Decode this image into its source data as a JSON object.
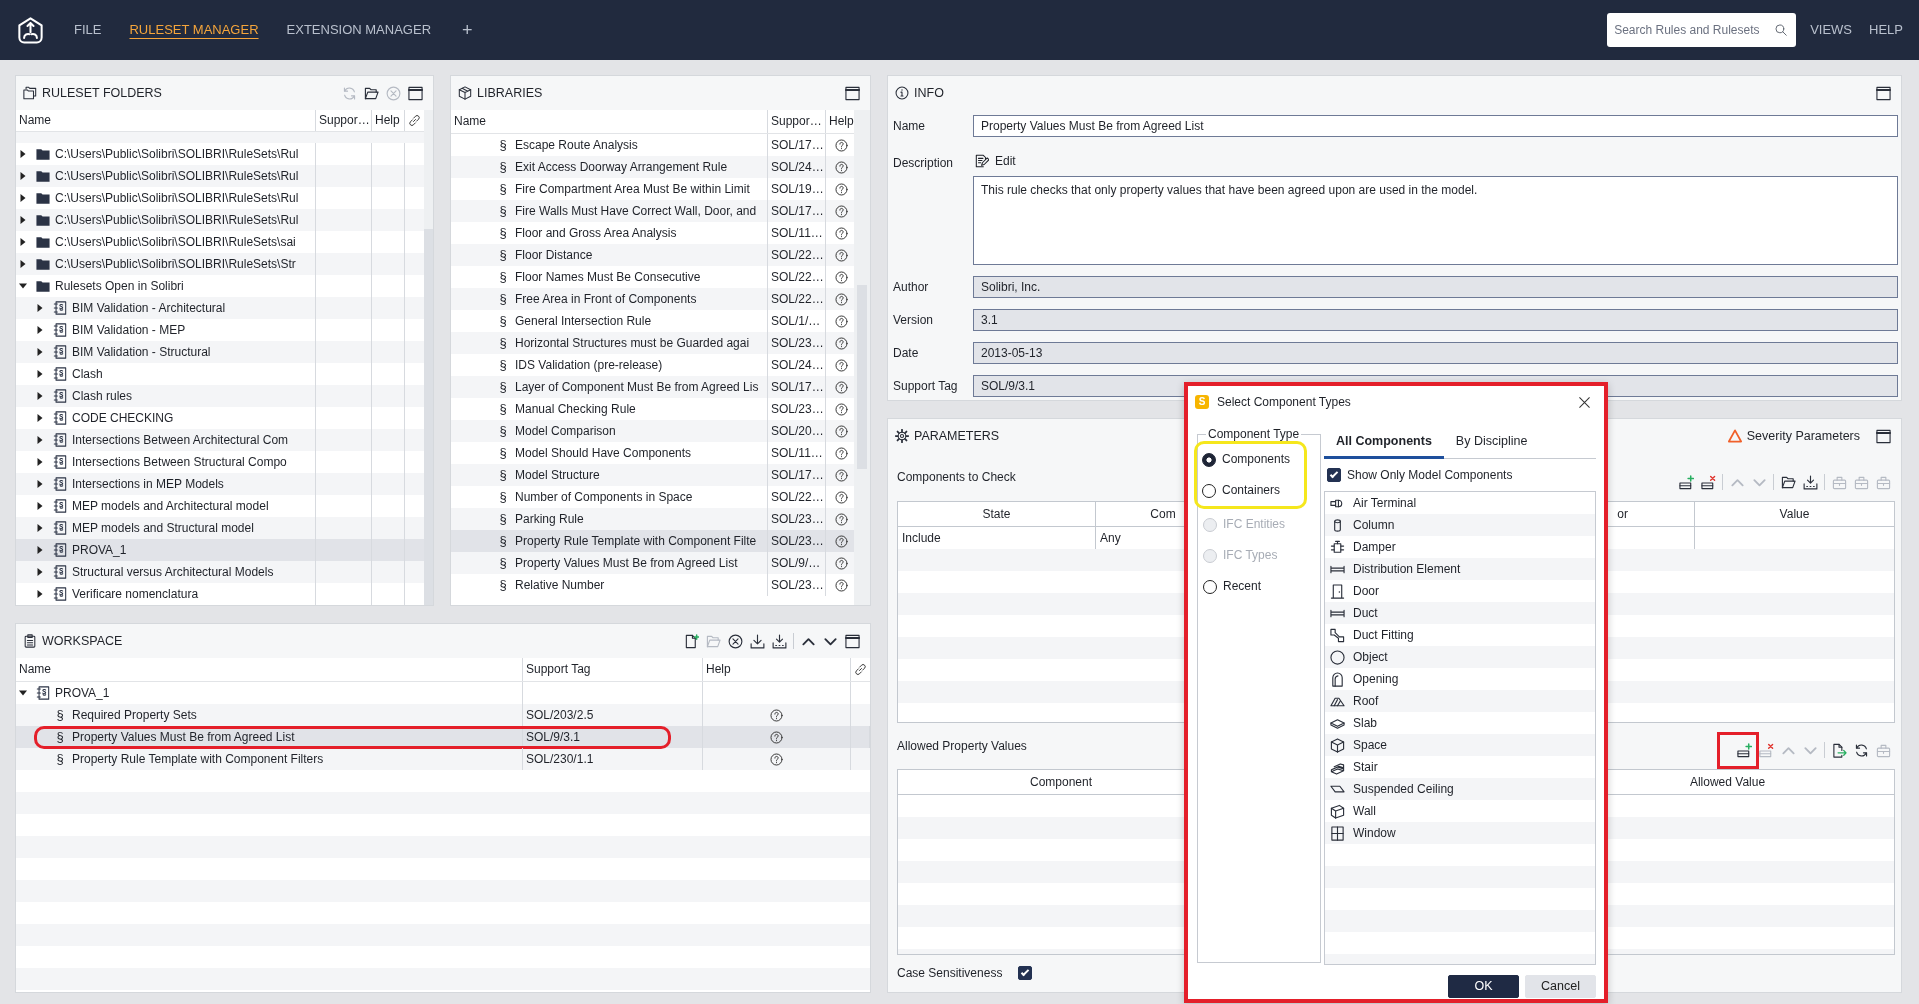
{
  "top_bar": {
    "menu": [
      {
        "label": "FILE",
        "selected": false
      },
      {
        "label": "RULESET MANAGER",
        "selected": true
      },
      {
        "label": "EXTENSION MANAGER",
        "selected": false
      }
    ],
    "add_tab": "+",
    "search": {
      "placeholder": "Search Rules and Rulesets"
    },
    "links": [
      "VIEWS",
      "HELP"
    ]
  },
  "ruleset_folders": {
    "title": "RULESET FOLDERS",
    "tools": [
      {
        "kind": "refresh",
        "disabled": true
      },
      {
        "kind": "open",
        "disabled": false
      },
      {
        "kind": "close",
        "disabled": true
      },
      {
        "kind": "maximize",
        "disabled": false
      }
    ],
    "columns": [
      "Name",
      "Suppor…",
      "Help"
    ],
    "tree": [
      {
        "kind": "folder",
        "label": "C:\\Users\\Public\\Solibri\\SOLIBRI\\RuleSets\\Rul",
        "expanded": false,
        "selected": false
      },
      {
        "kind": "folder",
        "label": "C:\\Users\\Public\\Solibri\\SOLIBRI\\RuleSets\\Rul",
        "expanded": false,
        "selected": false
      },
      {
        "kind": "folder",
        "label": "C:\\Users\\Public\\Solibri\\SOLIBRI\\RuleSets\\Rul",
        "expanded": false,
        "selected": false
      },
      {
        "kind": "folder",
        "label": "C:\\Users\\Public\\Solibri\\SOLIBRI\\RuleSets\\Rul",
        "expanded": false,
        "selected": false
      },
      {
        "kind": "folder",
        "label": "C:\\Users\\Public\\Solibri\\SOLIBRI\\RuleSets\\sai",
        "expanded": false,
        "selected": false
      },
      {
        "kind": "folder",
        "label": "C:\\Users\\Public\\Solibri\\SOLIBRI\\RuleSets\\Str",
        "expanded": false,
        "selected": false
      },
      {
        "kind": "folder",
        "label": "Rulesets Open in Solibri",
        "expanded": true,
        "selected": false,
        "children": [
          {
            "kind": "ruleset",
            "label": "BIM Validation - Architectural",
            "expanded": false,
            "selected": false
          },
          {
            "kind": "ruleset",
            "label": "BIM Validation - MEP",
            "expanded": false,
            "selected": false
          },
          {
            "kind": "ruleset",
            "label": "BIM Validation - Structural",
            "expanded": false,
            "selected": false
          },
          {
            "kind": "ruleset",
            "label": "Clash",
            "expanded": false,
            "selected": false
          },
          {
            "kind": "ruleset",
            "label": "Clash rules",
            "expanded": false,
            "selected": false
          },
          {
            "kind": "ruleset",
            "label": "CODE CHECKING",
            "expanded": false,
            "selected": false
          },
          {
            "kind": "ruleset",
            "label": "Intersections Between Architectural Com",
            "expanded": false,
            "selected": false
          },
          {
            "kind": "ruleset",
            "label": "Intersections Between Structural Compo",
            "expanded": false,
            "selected": false
          },
          {
            "kind": "ruleset",
            "label": "Intersections in MEP Models",
            "expanded": false,
            "selected": false
          },
          {
            "kind": "ruleset",
            "label": "MEP models and Architectural model",
            "expanded": false,
            "selected": false
          },
          {
            "kind": "ruleset",
            "label": "MEP models and Structural model",
            "expanded": false,
            "selected": false
          },
          {
            "kind": "ruleset",
            "label": "PROVA_1",
            "expanded": false,
            "selected": true
          },
          {
            "kind": "ruleset",
            "label": "Structural versus Architectural Models",
            "expanded": false,
            "selected": false
          },
          {
            "kind": "ruleset",
            "label": "Verificare nomenclatura",
            "expanded": false,
            "selected": false
          }
        ]
      }
    ]
  },
  "libraries": {
    "title": "LIBRARIES",
    "tools": [
      {
        "kind": "maximize",
        "disabled": false
      }
    ],
    "columns": [
      "Name",
      "Suppor…",
      "Help"
    ],
    "rows": [
      {
        "symbol": "§",
        "name": "Escape Route Analysis",
        "support_tag": "SOL/17…",
        "selected": false
      },
      {
        "symbol": "§",
        "name": "Exit Access Doorway Arrangement Rule",
        "support_tag": "SOL/24…",
        "selected": false
      },
      {
        "symbol": "§",
        "name": "Fire Compartment Area Must Be within Limit",
        "support_tag": "SOL/19…",
        "selected": false
      },
      {
        "symbol": "§",
        "name": "Fire Walls Must Have Correct Wall, Door, and",
        "support_tag": "SOL/17…",
        "selected": false
      },
      {
        "symbol": "§",
        "name": "Floor and Gross Area Analysis",
        "support_tag": "SOL/11…",
        "selected": false
      },
      {
        "symbol": "§",
        "name": "Floor Distance",
        "support_tag": "SOL/22…",
        "selected": false
      },
      {
        "symbol": "§",
        "name": "Floor Names Must Be Consecutive",
        "support_tag": "SOL/22…",
        "selected": false
      },
      {
        "symbol": "§",
        "name": "Free Area in Front of Components",
        "support_tag": "SOL/22…",
        "selected": false
      },
      {
        "symbol": "§",
        "name": "General Intersection Rule",
        "support_tag": "SOL/1/…",
        "selected": false
      },
      {
        "symbol": "§",
        "name": "Horizontal Structures must be Guarded agai",
        "support_tag": "SOL/23…",
        "selected": false
      },
      {
        "symbol": "§",
        "name": "IDS Validation (pre-release)",
        "support_tag": "SOL/24…",
        "selected": false
      },
      {
        "symbol": "§",
        "name": "Layer of Component Must Be from Agreed Lis",
        "support_tag": "SOL/17…",
        "selected": false
      },
      {
        "symbol": "§",
        "name": "Manual Checking Rule",
        "support_tag": "SOL/23…",
        "selected": false
      },
      {
        "symbol": "§",
        "name": "Model Comparison",
        "support_tag": "SOL/20…",
        "selected": false
      },
      {
        "symbol": "§",
        "name": "Model Should Have Components",
        "support_tag": "SOL/11…",
        "selected": false
      },
      {
        "symbol": "§",
        "name": "Model Structure",
        "support_tag": "SOL/17…",
        "selected": false
      },
      {
        "symbol": "§",
        "name": "Number of Components in Space",
        "support_tag": "SOL/22…",
        "selected": false
      },
      {
        "symbol": "§",
        "name": "Parking Rule",
        "support_tag": "SOL/23…",
        "selected": false
      },
      {
        "symbol": "§",
        "name": "Property Rule Template with Component Filte",
        "support_tag": "SOL/23…",
        "selected": true
      },
      {
        "symbol": "§",
        "name": "Property Values Must Be from Agreed List",
        "support_tag": "SOL/9/…",
        "selected": false
      },
      {
        "symbol": "§",
        "name": "Relative Number",
        "support_tag": "SOL/23…",
        "selected": false
      }
    ]
  },
  "workspace": {
    "title": "WORKSPACE",
    "tools": [
      {
        "kind": "new",
        "disabled": false
      },
      {
        "kind": "open",
        "disabled": true
      },
      {
        "kind": "close",
        "disabled": false
      },
      {
        "kind": "download",
        "disabled": false
      },
      {
        "kind": "tray",
        "disabled": false
      },
      {
        "kind": "separator"
      },
      {
        "kind": "up",
        "disabled": false
      },
      {
        "kind": "down",
        "disabled": false
      },
      {
        "kind": "maximize",
        "disabled": false
      }
    ],
    "columns": [
      "Name",
      "Support Tag",
      "Help"
    ],
    "tree": [
      {
        "kind": "ruleset",
        "label": "PROVA_1",
        "expanded": true,
        "selected": false,
        "highlighted": false,
        "children": [
          {
            "kind": "rule",
            "symbol": "§",
            "label": "Required Property Sets",
            "support_tag": "SOL/203/2.5",
            "selected": false,
            "highlighted": false
          },
          {
            "kind": "rule",
            "symbol": "§",
            "label": "Property Values Must Be from Agreed List",
            "support_tag": "SOL/9/3.1",
            "selected": true,
            "highlighted": true
          },
          {
            "kind": "rule",
            "symbol": "§",
            "label": "Property Rule Template with Component Filters",
            "support_tag": "SOL/230/1.1",
            "selected": false,
            "highlighted": false
          }
        ]
      }
    ]
  },
  "info": {
    "title": "INFO",
    "tools": [
      {
        "kind": "maximize",
        "disabled": false
      }
    ],
    "fields": [
      {
        "kind": "text",
        "label": "Name",
        "value": "Property Values Must Be from Agreed List"
      },
      {
        "kind": "description",
        "label": "Description",
        "edit": "Edit",
        "value": "This rule checks that only property values that have been agreed upon are used in the model."
      },
      {
        "kind": "readonly",
        "label": "Author",
        "value": "Solibri, Inc."
      },
      {
        "kind": "readonly",
        "label": "Version",
        "value": "3.1"
      },
      {
        "kind": "readonly",
        "label": "Date",
        "value": "2013-05-13"
      },
      {
        "kind": "readonly",
        "label": "Support Tag",
        "value": "SOL/9/3.1"
      }
    ]
  },
  "parameters": {
    "title": "PARAMETERS",
    "severity": "Severity Parameters",
    "tools": [
      {
        "kind": "maximize",
        "disabled": false
      }
    ],
    "components_to_check": {
      "label": "Components to Check",
      "tools": [
        {
          "kind": "addrow",
          "disabled": false
        },
        {
          "kind": "removerow",
          "disabled": false
        },
        {
          "kind": "separator"
        },
        {
          "kind": "up",
          "disabled": true
        },
        {
          "kind": "down",
          "disabled": true
        },
        {
          "kind": "separator"
        },
        {
          "kind": "folder",
          "disabled": false
        },
        {
          "kind": "tray",
          "disabled": false
        },
        {
          "kind": "separator"
        },
        {
          "kind": "box",
          "disabled": true
        },
        {
          "kind": "box",
          "disabled": true
        },
        {
          "kind": "box",
          "disabled": true
        }
      ],
      "columns": [
        "State",
        "Com",
        "or",
        "Value"
      ],
      "rows": [
        [
          "Include",
          "Any"
        ]
      ]
    },
    "allowed_property_values": {
      "label": "Allowed Property Values",
      "tools": [
        {
          "kind": "addrow",
          "disabled": false,
          "highlighted": true
        },
        {
          "kind": "removerow",
          "disabled": true,
          "highlighted": false
        },
        {
          "kind": "up",
          "disabled": true,
          "highlighted": false
        },
        {
          "kind": "down",
          "disabled": true,
          "highlighted": false
        },
        {
          "kind": "separator"
        },
        {
          "kind": "export",
          "disabled": false,
          "highlighted": false
        },
        {
          "kind": "refresh",
          "disabled": false,
          "highlighted": false
        },
        {
          "kind": "box",
          "disabled": true,
          "highlighted": false
        }
      ],
      "columns": [
        "Component",
        "Allowed Value"
      ]
    },
    "case_sensitiveness": {
      "label": "Case Sensitiveness",
      "checked": true
    }
  },
  "dialog": {
    "app_badge": "S",
    "title": "Select Component Types",
    "highlighted": true,
    "component_type": {
      "legend": "Component Type",
      "options": [
        {
          "label": "Components",
          "selected": true,
          "disabled": false,
          "highlighted": true
        },
        {
          "label": "Containers",
          "selected": false,
          "disabled": false,
          "highlighted": true
        },
        {
          "label": "IFC Entities",
          "selected": false,
          "disabled": true,
          "highlighted": false
        },
        {
          "label": "IFC Types",
          "selected": false,
          "disabled": true,
          "highlighted": false
        },
        {
          "label": "Recent",
          "selected": false,
          "disabled": false,
          "highlighted": false
        }
      ]
    },
    "tabs": [
      {
        "label": "All Components",
        "selected": true
      },
      {
        "label": "By Discipline",
        "selected": false
      }
    ],
    "filter": {
      "label": "Show Only Model Components",
      "checked": true
    },
    "items": [
      {
        "kind": "terminal",
        "label": "Air Terminal"
      },
      {
        "kind": "column",
        "label": "Column"
      },
      {
        "kind": "damper",
        "label": "Damper"
      },
      {
        "kind": "element",
        "label": "Distribution Element"
      },
      {
        "kind": "door",
        "label": "Door"
      },
      {
        "kind": "duct",
        "label": "Duct"
      },
      {
        "kind": "fitting",
        "label": "Duct Fitting"
      },
      {
        "kind": "object",
        "label": "Object"
      },
      {
        "kind": "opening",
        "label": "Opening"
      },
      {
        "kind": "roof",
        "label": "Roof"
      },
      {
        "kind": "slab",
        "label": "Slab"
      },
      {
        "kind": "space",
        "label": "Space"
      },
      {
        "kind": "stair",
        "label": "Stair"
      },
      {
        "kind": "ceiling",
        "label": "Suspended Ceiling"
      },
      {
        "kind": "wall",
        "label": "Wall"
      },
      {
        "kind": "window",
        "label": "Window"
      }
    ],
    "buttons": [
      {
        "kind": "primary",
        "label": "OK"
      },
      {
        "kind": "secondary",
        "label": "Cancel"
      }
    ]
  }
}
